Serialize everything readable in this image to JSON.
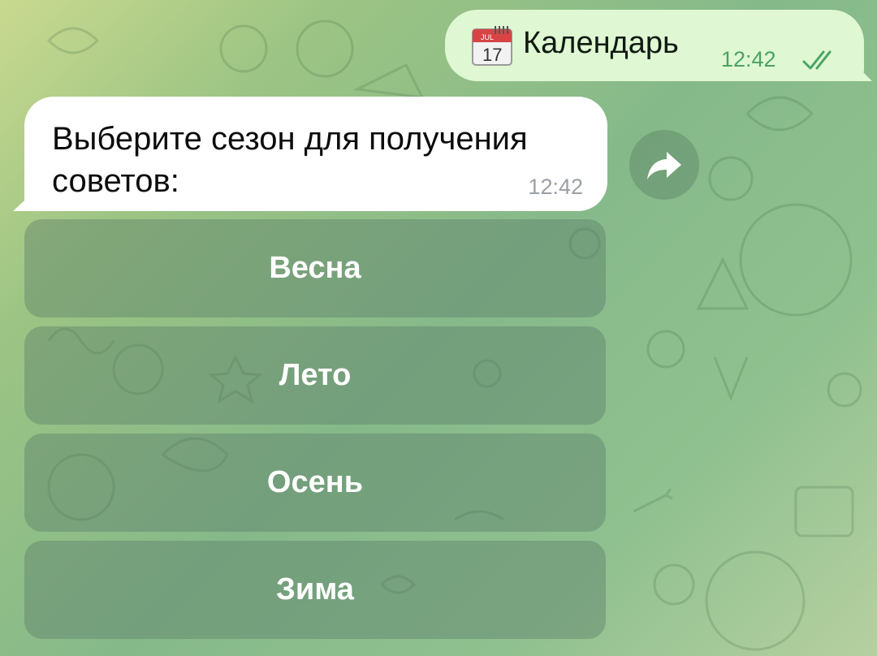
{
  "outgoing_message": {
    "text": "Календарь",
    "time": "12:42",
    "calendar_icon": {
      "month": "JUL",
      "day": "17"
    },
    "status": "read"
  },
  "incoming_message": {
    "text": "Выберите сезон для получения советов:",
    "time": "12:42"
  },
  "keyboard": {
    "buttons": [
      {
        "label": "Весна"
      },
      {
        "label": "Лето"
      },
      {
        "label": "Осень"
      },
      {
        "label": "Зима"
      }
    ]
  },
  "colors": {
    "outgoing_bubble": "#dff7d2",
    "incoming_bubble": "#ffffff",
    "time_outgoing": "#4aa363",
    "time_incoming": "#9aa0a6",
    "keyboard_button": "rgba(90,125,105,0.42)"
  }
}
